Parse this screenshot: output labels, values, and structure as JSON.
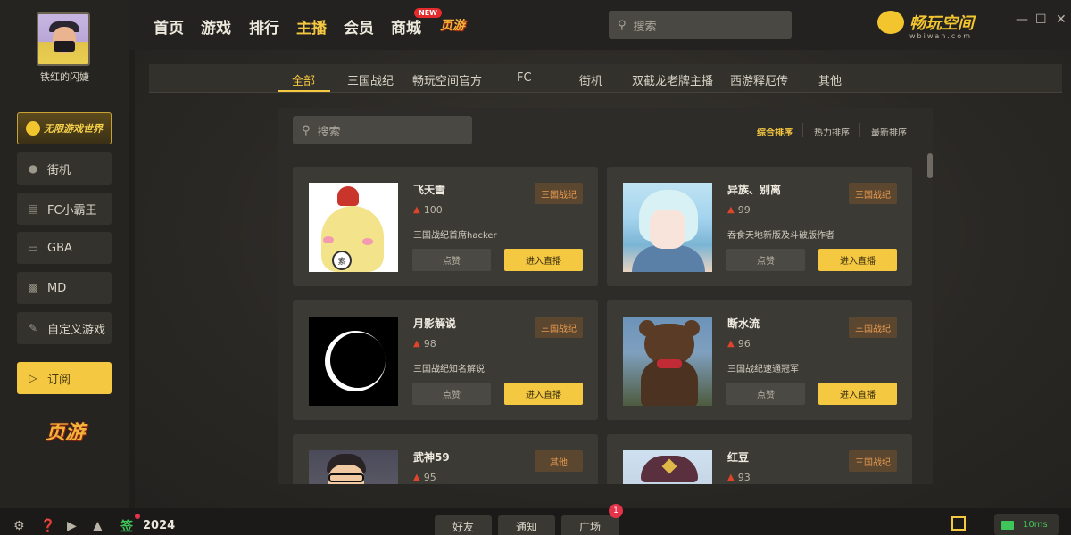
{
  "sidebar": {
    "username": "铁红的闪婕",
    "game_world": "无限游戏世界",
    "items": [
      {
        "label": "街机",
        "icon": "arcade-icon"
      },
      {
        "label": "FC小霸王",
        "icon": "fc-console-icon"
      },
      {
        "label": "GBA",
        "icon": "gba-icon"
      },
      {
        "label": "MD",
        "icon": "gamepad-icon"
      },
      {
        "label": "自定义游戏",
        "icon": "edit-icon"
      },
      {
        "label": "订阅",
        "icon": "subscribe-icon",
        "active": true
      }
    ],
    "yeyou": "页游"
  },
  "topnav": {
    "items": [
      "首页",
      "游戏",
      "排行",
      "主播",
      "会员",
      "商城"
    ],
    "active": "主播",
    "new_badge": "NEW",
    "yeyou": "页游",
    "search_placeholder": "搜索",
    "brand_name": "畅玩空间",
    "brand_sub": "wbiwan.com"
  },
  "tabs": {
    "items": [
      "全部",
      "三国战纪",
      "畅玩空间官方",
      "FC",
      "街机",
      "双截龙老牌主播",
      "西游释厄传",
      "其他"
    ],
    "active": "全部"
  },
  "panel": {
    "search_placeholder": "搜索",
    "sort": [
      "综合排序",
      "热力排序",
      "最新排序"
    ],
    "active_sort": "综合排序",
    "like_label": "点赞",
    "enter_label": "进入直播"
  },
  "streamers": [
    {
      "name": "飞天雪",
      "heat": "100",
      "desc": "三国战纪首席hacker",
      "tag": "三国战纪",
      "thumb": "chicken-avatar"
    },
    {
      "name": "异族、别离",
      "heat": "99",
      "desc": "吞食天地新版及斗破版作者",
      "tag": "三国战纪",
      "thumb": "anime-avatar"
    },
    {
      "name": "月影解说",
      "heat": "98",
      "desc": "三国战纪知名解说",
      "tag": "三国战纪",
      "thumb": "moon-avatar"
    },
    {
      "name": "断水流",
      "heat": "96",
      "desc": "三国战纪速通冠军",
      "tag": "三国战纪",
      "thumb": "bear-avatar"
    },
    {
      "name": "武神59",
      "heat": "95",
      "desc": "",
      "tag": "其他",
      "thumb": "man-avatar"
    },
    {
      "name": "红豆",
      "heat": "93",
      "desc": "",
      "tag": "三国战纪",
      "thumb": "officer-avatar"
    }
  ],
  "statusbar": {
    "sign": "签",
    "year": "2024",
    "buttons": [
      "好友",
      "通知",
      "广场"
    ],
    "notification_count": "1",
    "latency": "10ms"
  },
  "colors": {
    "accent": "#f5c842",
    "tag_text": "#e79a4f",
    "online": "#3fc65a",
    "alert": "#e5334a"
  }
}
